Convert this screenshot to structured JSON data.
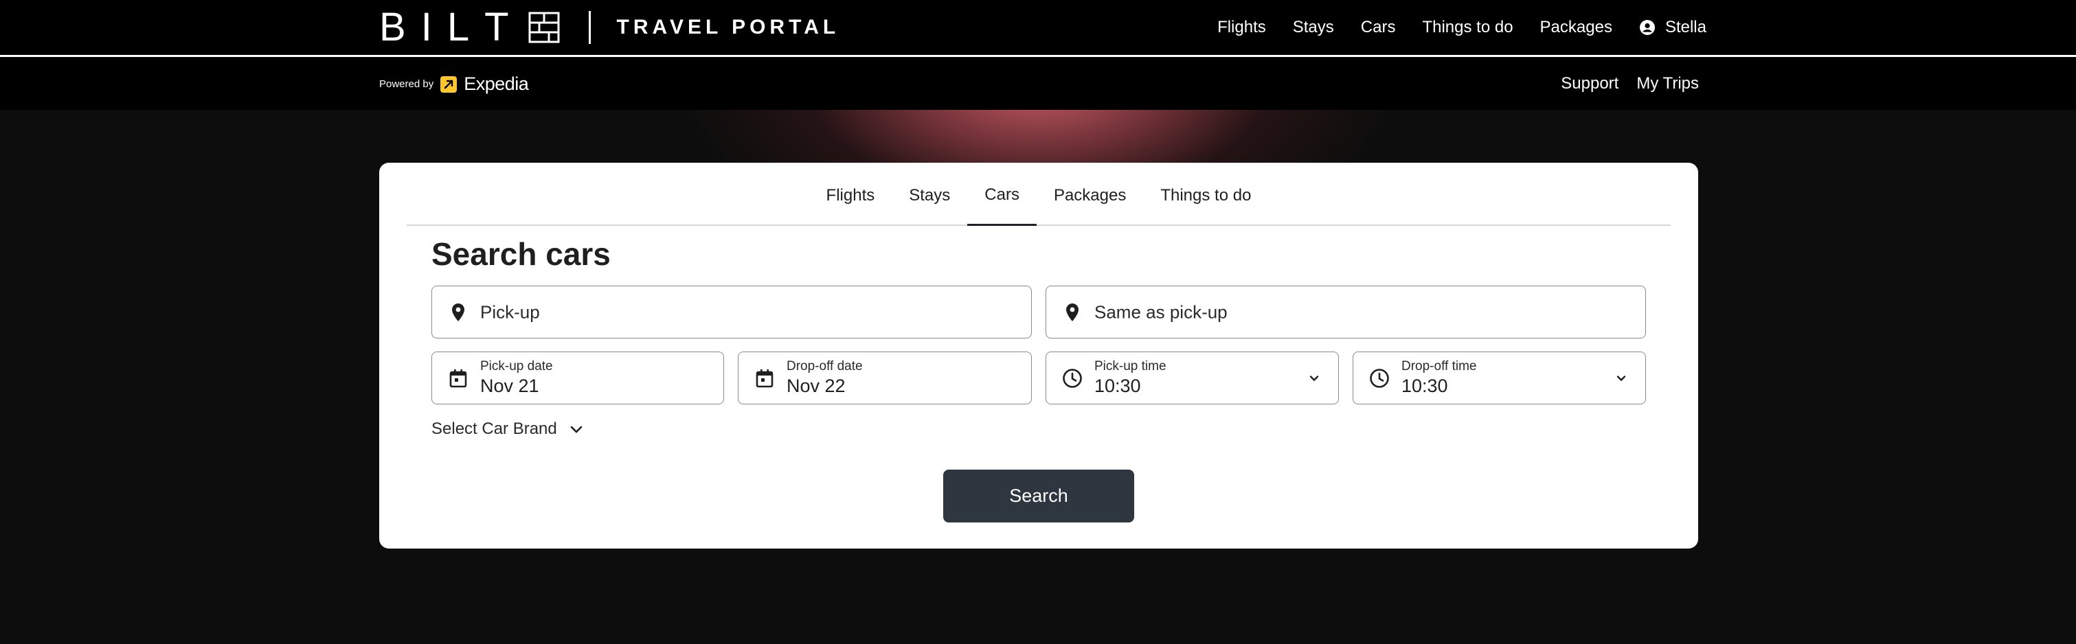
{
  "brand": {
    "logo_letters": [
      "B",
      "I",
      "L",
      "T"
    ],
    "portal_title": "TRAVEL PORTAL",
    "powered_by": "Powered by",
    "partner_name": "Expedia"
  },
  "top_nav": {
    "items": [
      "Flights",
      "Stays",
      "Cars",
      "Things to do",
      "Packages"
    ],
    "user_name": "Stella"
  },
  "sub_nav": {
    "support": "Support",
    "my_trips": "My Trips"
  },
  "search_tabs": {
    "items": [
      "Flights",
      "Stays",
      "Cars",
      "Packages",
      "Things to do"
    ],
    "active": "Cars"
  },
  "form": {
    "title": "Search cars",
    "pickup_placeholder": "Pick-up",
    "dropoff_placeholder": "Same as pick-up",
    "pickup_date_label": "Pick-up date",
    "pickup_date_value": "Nov 21",
    "dropoff_date_label": "Drop-off date",
    "dropoff_date_value": "Nov 22",
    "pickup_time_label": "Pick-up time",
    "pickup_time_value": "10:30",
    "dropoff_time_label": "Drop-off time",
    "dropoff_time_value": "10:30",
    "car_brand_label": "Select Car Brand",
    "search_button": "Search"
  },
  "colors": {
    "background": "#0b0b0b",
    "glow": "#d6606a",
    "partner_yellow": "#ffc72c",
    "button": "#2e3740"
  },
  "icons": [
    "grid-logo-icon",
    "user-icon",
    "expedia-mark-icon",
    "location-pin-icon",
    "calendar-icon",
    "clock-icon",
    "chevron-down-icon"
  ]
}
